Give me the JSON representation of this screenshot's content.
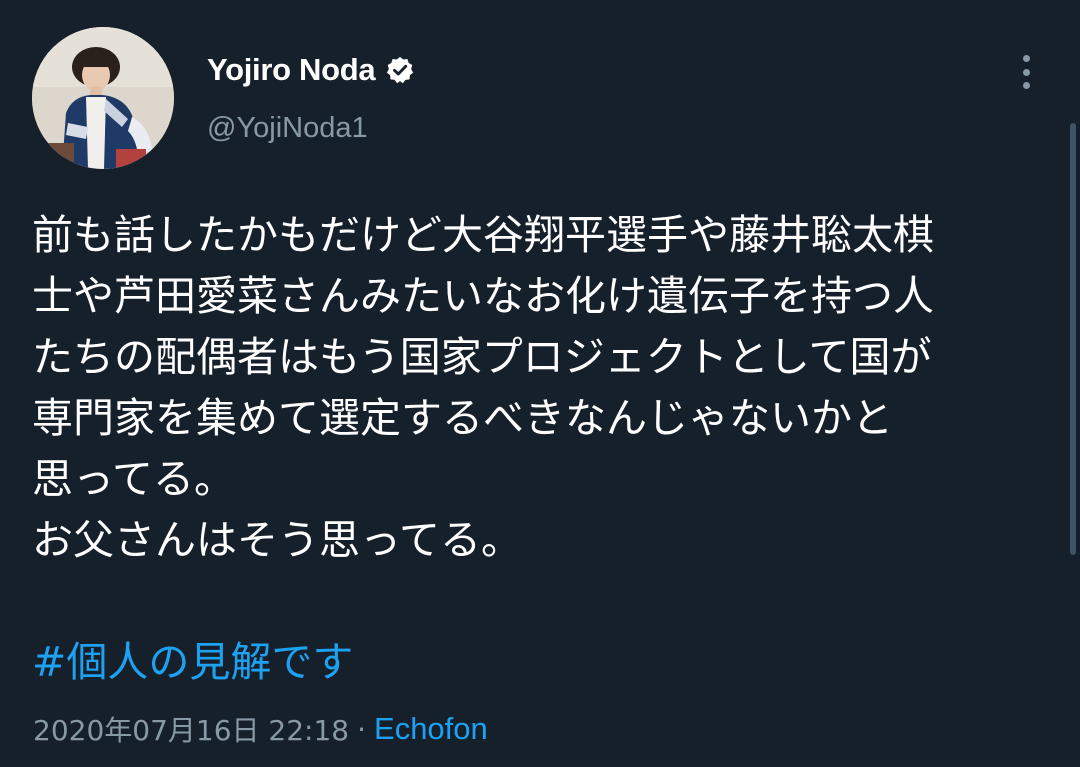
{
  "user": {
    "display_name": "Yojiro Noda",
    "handle": "@YojiNoda1",
    "verified": true,
    "verified_icon": "verified-badge-icon",
    "avatar_icon": "profile-photo"
  },
  "menu": {
    "icon": "more-vertical-icon"
  },
  "tweet": {
    "lines": [
      "前も話したかもだけど大谷翔平選手や藤井聡太棋",
      "士や芦田愛菜さんみたいなお化け遺伝子を持つ人",
      "たちの配偶者はもう国家プロジェクトとして国が",
      "専門家を集めて選定するべきなんじゃないかと",
      "思ってる。",
      "お父さんはそう思ってる。"
    ],
    "hashtag": "#個人の見解です",
    "timestamp": "2020年07月16日 22:18",
    "separator": "·",
    "source": "Echofon"
  },
  "colors": {
    "background": "#15202b",
    "text": "#ffffff",
    "secondary": "#8899a6",
    "accent": "#1da1f2"
  }
}
